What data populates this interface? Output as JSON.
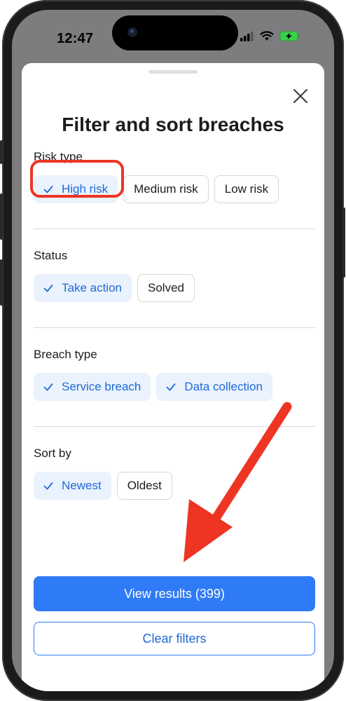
{
  "status_bar": {
    "time": "12:47"
  },
  "sheet": {
    "title": "Filter and sort breaches",
    "sections": [
      {
        "label": "Risk type",
        "chips": [
          {
            "label": "High risk",
            "selected": true
          },
          {
            "label": "Medium risk",
            "selected": false
          },
          {
            "label": "Low risk",
            "selected": false
          }
        ]
      },
      {
        "label": "Status",
        "chips": [
          {
            "label": "Take action",
            "selected": true
          },
          {
            "label": "Solved",
            "selected": false
          }
        ]
      },
      {
        "label": "Breach type",
        "chips": [
          {
            "label": "Service breach",
            "selected": true
          },
          {
            "label": "Data collection",
            "selected": true
          }
        ]
      },
      {
        "label": "Sort by",
        "chips": [
          {
            "label": "Newest",
            "selected": true
          },
          {
            "label": "Oldest",
            "selected": false
          }
        ]
      }
    ],
    "view_results_label": "View results (399)",
    "clear_filters_label": "Clear filters"
  },
  "colors": {
    "accent": "#2f7af6",
    "selected_chip_bg": "#eaf2fd",
    "annotation": "#ee3524"
  },
  "icons": {
    "close": "close-icon",
    "check": "checkmark-icon"
  }
}
